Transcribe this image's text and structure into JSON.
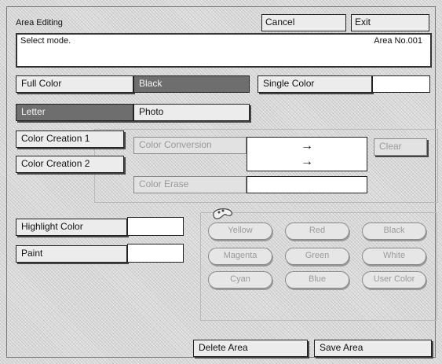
{
  "window": {
    "title": "Area Editing"
  },
  "toolbar": {
    "cancel_label": "Cancel",
    "exit_label": "Exit"
  },
  "status": {
    "message": "Select mode.",
    "area_no": "Area No.001"
  },
  "color_mode": {
    "full_color": "Full Color",
    "black": "Black",
    "single_color": "Single Color"
  },
  "original_type": {
    "letter": "Letter",
    "photo": "Photo"
  },
  "color_creation": {
    "item1": "Color Creation 1",
    "item2": "Color Creation 2",
    "conversion_label": "Color Conversion",
    "erase_label": "Color Erase",
    "clear_label": "Clear",
    "arrow1": "→",
    "arrow2": "→"
  },
  "highlight": {
    "highlight_color": "Highlight Color",
    "paint": "Paint"
  },
  "palette": {
    "colors": [
      "Yellow",
      "Red",
      "Black",
      "Magenta",
      "Green",
      "White",
      "Cyan",
      "Blue",
      "User Color"
    ]
  },
  "footer": {
    "delete_area": "Delete Area",
    "save_area": "Save Area"
  }
}
